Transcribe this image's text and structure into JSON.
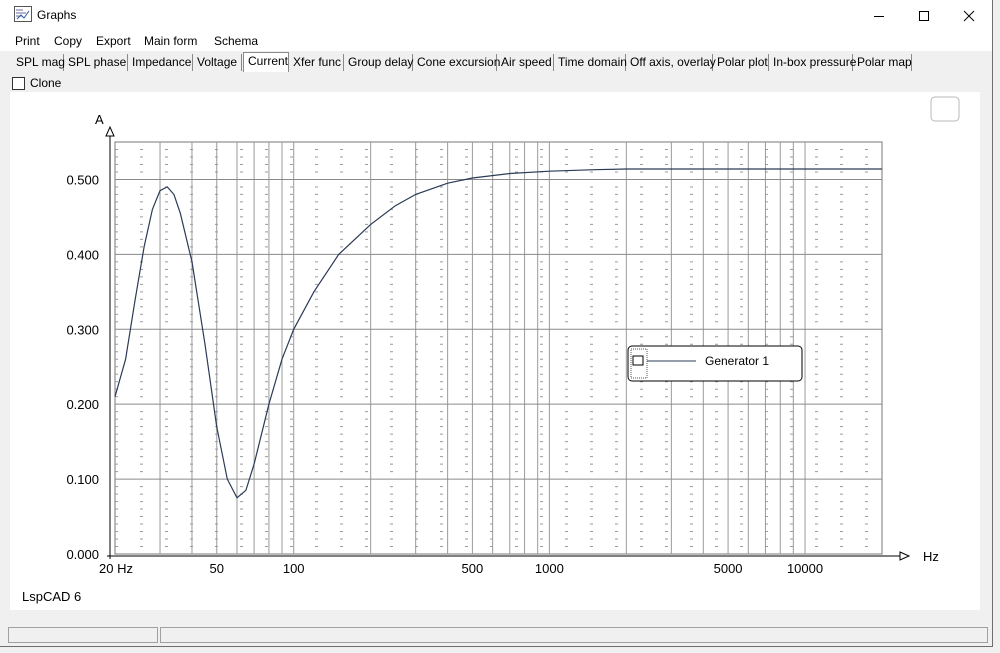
{
  "window": {
    "title": "Graphs"
  },
  "menu": [
    "Print",
    "Copy",
    "Export",
    "Main form",
    "Schema"
  ],
  "tabs": [
    "SPL mag",
    "SPL phase",
    "Impedance",
    "Voltage",
    "Current",
    "Xfer func",
    "Group delay",
    "Cone excursion",
    "Air speed",
    "Time domain",
    "Off axis, overlay",
    "Polar plot",
    "In-box pressure",
    "Polar map"
  ],
  "active_tab": "Current",
  "clone": {
    "label": "Clone",
    "checked": false
  },
  "footer_label": "LspCAD 6",
  "chart_data": {
    "type": "line",
    "xscale": "log",
    "xlim": [
      20,
      20000
    ],
    "ylim": [
      0,
      0.55
    ],
    "xlabel": "Hz",
    "ylabel": "A",
    "y_ticks": [
      "0.000",
      "0.100",
      "0.200",
      "0.300",
      "0.400",
      "0.500"
    ],
    "x_ticks": [
      {
        "value": 20,
        "label": "20 Hz"
      },
      {
        "value": 50,
        "label": "50"
      },
      {
        "value": 100,
        "label": "100"
      },
      {
        "value": 500,
        "label": "500"
      },
      {
        "value": 1000,
        "label": "1000"
      },
      {
        "value": 5000,
        "label": "5000"
      },
      {
        "value": 10000,
        "label": "10000"
      }
    ],
    "series": [
      {
        "name": "Generator 1",
        "color": "#2b3a55",
        "points": [
          [
            20,
            0.21
          ],
          [
            22,
            0.26
          ],
          [
            24,
            0.34
          ],
          [
            26,
            0.41
          ],
          [
            28,
            0.46
          ],
          [
            30,
            0.485
          ],
          [
            32,
            0.49
          ],
          [
            34,
            0.48
          ],
          [
            36,
            0.455
          ],
          [
            40,
            0.39
          ],
          [
            45,
            0.28
          ],
          [
            50,
            0.17
          ],
          [
            55,
            0.1
          ],
          [
            60,
            0.075
          ],
          [
            65,
            0.085
          ],
          [
            70,
            0.12
          ],
          [
            80,
            0.2
          ],
          [
            90,
            0.26
          ],
          [
            100,
            0.3
          ],
          [
            120,
            0.35
          ],
          [
            150,
            0.4
          ],
          [
            200,
            0.44
          ],
          [
            250,
            0.465
          ],
          [
            300,
            0.48
          ],
          [
            400,
            0.495
          ],
          [
            500,
            0.502
          ],
          [
            700,
            0.508
          ],
          [
            1000,
            0.511
          ],
          [
            1500,
            0.513
          ],
          [
            2000,
            0.514
          ],
          [
            5000,
            0.514
          ],
          [
            10000,
            0.514
          ],
          [
            20000,
            0.514
          ]
        ]
      }
    ],
    "legend": {
      "placement": "right",
      "entries": [
        "Generator 1"
      ]
    }
  }
}
